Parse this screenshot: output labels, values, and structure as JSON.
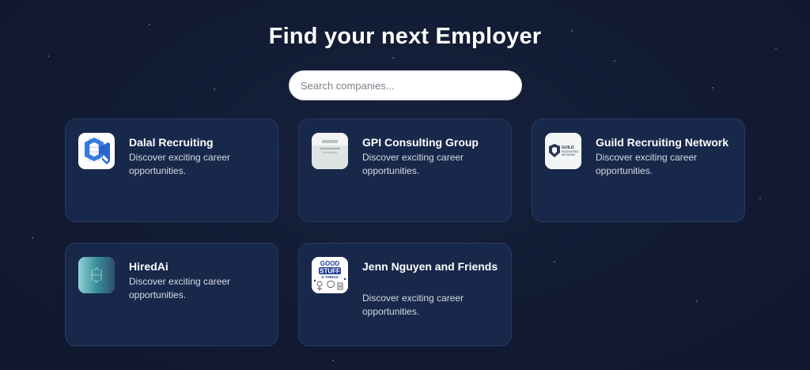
{
  "page": {
    "title": "Find your next Employer"
  },
  "search": {
    "placeholder": "Search companies..."
  },
  "companies": [
    {
      "name": "Dalal Recruiting",
      "description": "Discover exciting career opportunities.",
      "logo_icon": "dalal-recruiting-logo-icon"
    },
    {
      "name": "GPI Consulting Group",
      "description": "Discover exciting career opportunities.",
      "logo_icon": "gpi-consulting-logo-icon"
    },
    {
      "name": "Guild Recruiting Network",
      "description": "Discover exciting career opportunities.",
      "logo_icon": "guild-recruiting-logo-icon",
      "logo_text": [
        "GUILD",
        "RECRUITING",
        "NETWORK"
      ]
    },
    {
      "name": "HiredAi",
      "description": "Discover exciting career opportunities.",
      "logo_icon": "hiredai-logo-icon"
    },
    {
      "name": "Jenn Nguyen and Friends",
      "description": "Discover exciting career opportunities.",
      "logo_icon": "jenn-nguyen-logo-icon",
      "logo_text": [
        "GOOD",
        "STUFF",
        "& THINGS"
      ]
    }
  ],
  "colors": {
    "background": "#121b33",
    "card_background": "#18284a",
    "card_border": "#273a63",
    "title_text": "#ffffff",
    "description_text": "#d6dbe6"
  }
}
